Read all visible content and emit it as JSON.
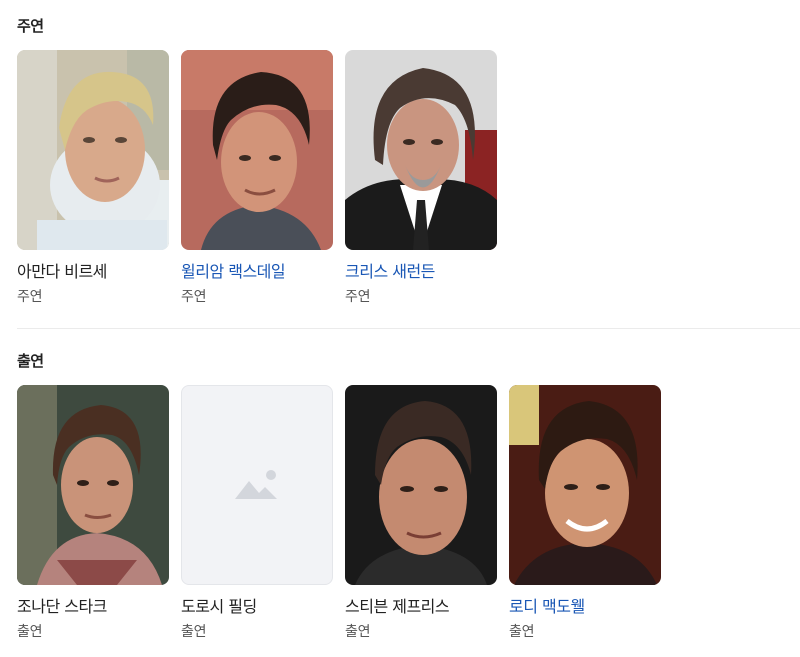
{
  "sections": [
    {
      "title": "주연",
      "people": [
        {
          "name": "아만다 비르세",
          "role": "주연",
          "link": false
        },
        {
          "name": "윌리암 랙스데일",
          "role": "주연",
          "link": true
        },
        {
          "name": "크리스 새런든",
          "role": "주연",
          "link": true
        }
      ]
    },
    {
      "title": "출연",
      "people": [
        {
          "name": "조나단 스타크",
          "role": "출연",
          "link": false
        },
        {
          "name": "도로시 필딩",
          "role": "출연",
          "link": false
        },
        {
          "name": "스티븐 제프리스",
          "role": "출연",
          "link": false
        },
        {
          "name": "로디 맥도웰",
          "role": "출연",
          "link": true
        }
      ]
    }
  ],
  "colors": {
    "link": "#1a57b5",
    "text": "#222222",
    "subtext": "#555555",
    "placeholder_bg": "#f2f3f6"
  },
  "icons": {
    "placeholder": "image-placeholder-icon"
  }
}
